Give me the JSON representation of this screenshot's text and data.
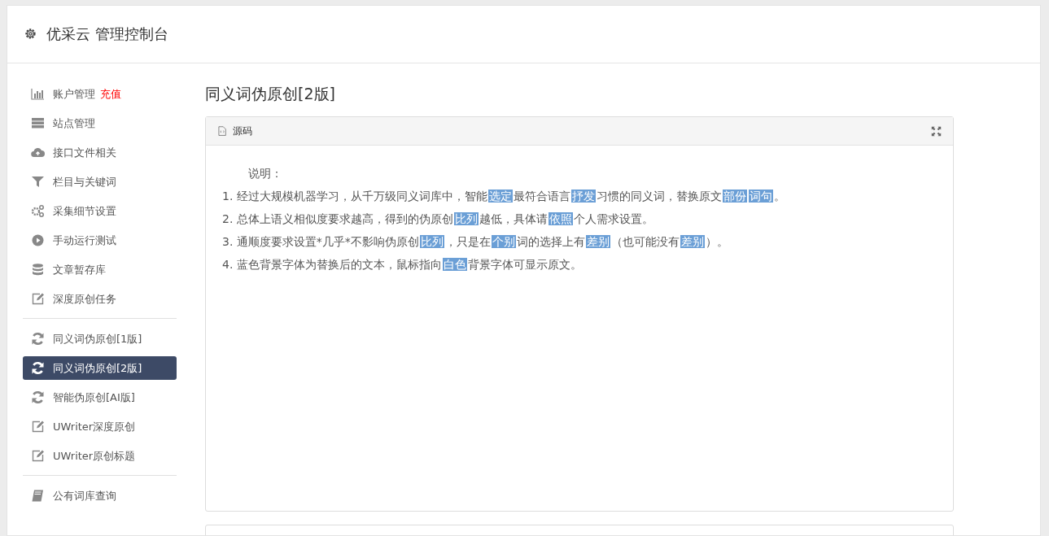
{
  "header": {
    "title": "优采云 管理控制台"
  },
  "sidebar": {
    "groups": [
      {
        "items": [
          {
            "kind": "chart",
            "label": "账户管理",
            "badge": "充值",
            "selected": false
          },
          {
            "kind": "server",
            "label": "站点管理",
            "selected": false
          },
          {
            "kind": "cloud",
            "label": "接口文件相关",
            "selected": false
          },
          {
            "kind": "filter",
            "label": "栏目与关键词",
            "selected": false
          },
          {
            "kind": "gears",
            "label": "采集细节设置",
            "selected": false
          },
          {
            "kind": "play",
            "label": "手动运行测试",
            "selected": false
          },
          {
            "kind": "database",
            "label": "文章暂存库",
            "selected": false
          },
          {
            "kind": "edit",
            "label": "深度原创任务",
            "selected": false
          }
        ]
      },
      {
        "items": [
          {
            "kind": "refresh",
            "label": "同义词伪原创[1版]",
            "selected": false
          },
          {
            "kind": "refresh",
            "label": "同义词伪原创[2版]",
            "selected": true
          },
          {
            "kind": "refresh",
            "label": "智能伪原创[AI版]",
            "selected": false
          },
          {
            "kind": "edit",
            "label": "UWriter深度原创",
            "selected": false
          },
          {
            "kind": "edit",
            "label": "UWriter原创标题",
            "selected": false
          }
        ]
      },
      {
        "items": [
          {
            "kind": "book",
            "label": "公有词库查询",
            "selected": false
          }
        ]
      }
    ]
  },
  "main": {
    "title": "同义词伪原创[2版]",
    "panel": {
      "title": "源码",
      "intro": "说明：",
      "lines": [
        [
          {
            "text": "1. 经过大规模机器学习，从千万级同义词库中，智能"
          },
          {
            "text": "选定",
            "highlight": true
          },
          {
            "text": "最符合语言"
          },
          {
            "text": "抒发",
            "highlight": true
          },
          {
            "text": "习惯的同义词，替换原文"
          },
          {
            "text": "部份",
            "highlight": true
          },
          {
            "text": "词句",
            "highlight": true
          },
          {
            "text": "。"
          }
        ],
        [
          {
            "text": "2. 总体上语义相似度要求越高，得到的伪原创"
          },
          {
            "text": "比列",
            "highlight": true
          },
          {
            "text": "越低，具体请"
          },
          {
            "text": "依照",
            "highlight": true
          },
          {
            "text": "个人需求设置。"
          }
        ],
        [
          {
            "text": "3. 通顺度要求设置*几乎*不影响伪原创"
          },
          {
            "text": "比列",
            "highlight": true
          },
          {
            "text": "，只是在"
          },
          {
            "text": "个别",
            "highlight": true
          },
          {
            "text": "词的选择上有"
          },
          {
            "text": "差别",
            "highlight": true
          },
          {
            "text": "（也可能没有"
          },
          {
            "text": "差别",
            "highlight": true
          },
          {
            "text": "）。"
          }
        ],
        [
          {
            "text": "4. 蓝色背景字体为替换后的文本，鼠标指向"
          },
          {
            "text": "白色",
            "highlight": true
          },
          {
            "text": "背景字体可显示原文。"
          }
        ]
      ]
    }
  }
}
